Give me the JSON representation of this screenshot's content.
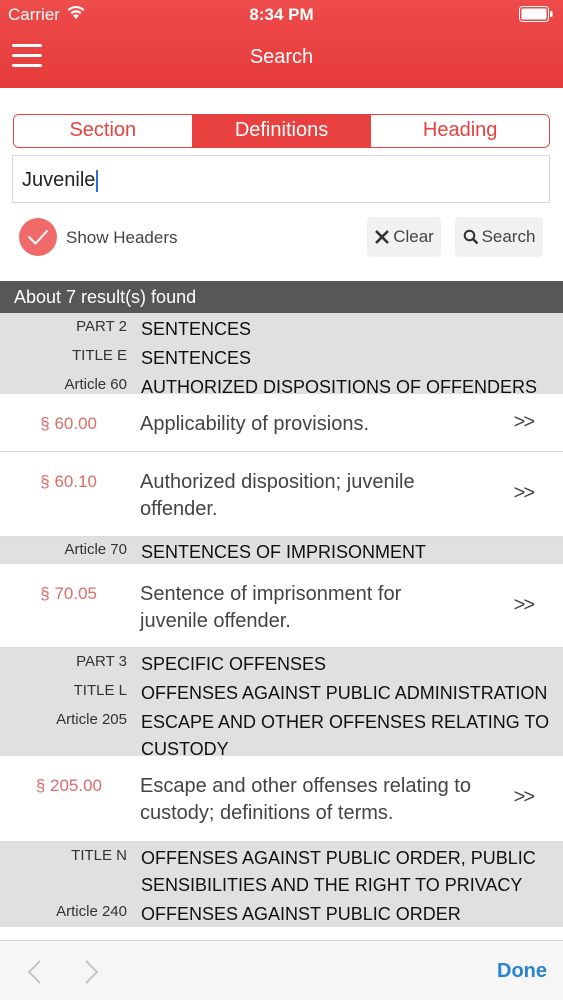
{
  "status": {
    "carrier": "Carrier",
    "time": "8:34 PM"
  },
  "header": {
    "title": "Search"
  },
  "tabs": [
    {
      "label": "Section",
      "active": false
    },
    {
      "label": "Definitions",
      "active": true
    },
    {
      "label": "Heading",
      "active": false
    }
  ],
  "search": {
    "value": "Juvenile"
  },
  "options": {
    "show_headers_label": "Show Headers",
    "show_headers_checked": true
  },
  "buttons": {
    "clear": "Clear",
    "search": "Search"
  },
  "results": {
    "summary": "About 7 result(s) found",
    "groups": [
      {
        "headers": [
          {
            "key": "PART 2",
            "value": "SENTENCES"
          },
          {
            "key": "TITLE E",
            "value": "SENTENCES"
          },
          {
            "key": "Article 60",
            "value": "AUTHORIZED DISPOSITIONS OF OFFENDERS"
          }
        ]
      },
      {
        "section": "§ 60.00",
        "title": "Applicability of provisions.",
        "arrow": ">>"
      },
      {
        "section": "§ 60.10",
        "title": "Authorized disposition; juvenile offender.",
        "arrow": ">>"
      },
      {
        "headers": [
          {
            "key": "Article 70",
            "value": "SENTENCES OF IMPRISONMENT"
          }
        ]
      },
      {
        "section": "§ 70.05",
        "title": "Sentence of imprisonment for juvenile offender.",
        "arrow": ">>"
      },
      {
        "headers": [
          {
            "key": "PART 3",
            "value": "SPECIFIC OFFENSES"
          },
          {
            "key": "TITLE L",
            "value": "OFFENSES AGAINST PUBLIC ADMINISTRATION"
          },
          {
            "key": "Article 205",
            "value": "ESCAPE AND OTHER OFFENSES RELATING TO CUSTODY"
          }
        ]
      },
      {
        "section": "§ 205.00",
        "title": "Escape and other offenses relating to custody; definitions of terms.",
        "arrow": ">>"
      },
      {
        "headers": [
          {
            "key": "TITLE N",
            "value": "OFFENSES AGAINST PUBLIC ORDER, PUBLIC SENSIBILITIES AND THE RIGHT TO PRIVACY"
          },
          {
            "key": "Article 240",
            "value": "OFFENSES AGAINST PUBLIC ORDER"
          }
        ]
      }
    ]
  },
  "toolbar": {
    "done": "Done"
  },
  "colors": {
    "accent": "#e8413f",
    "section_number": "#e06a6a",
    "done": "#2a84d6"
  }
}
